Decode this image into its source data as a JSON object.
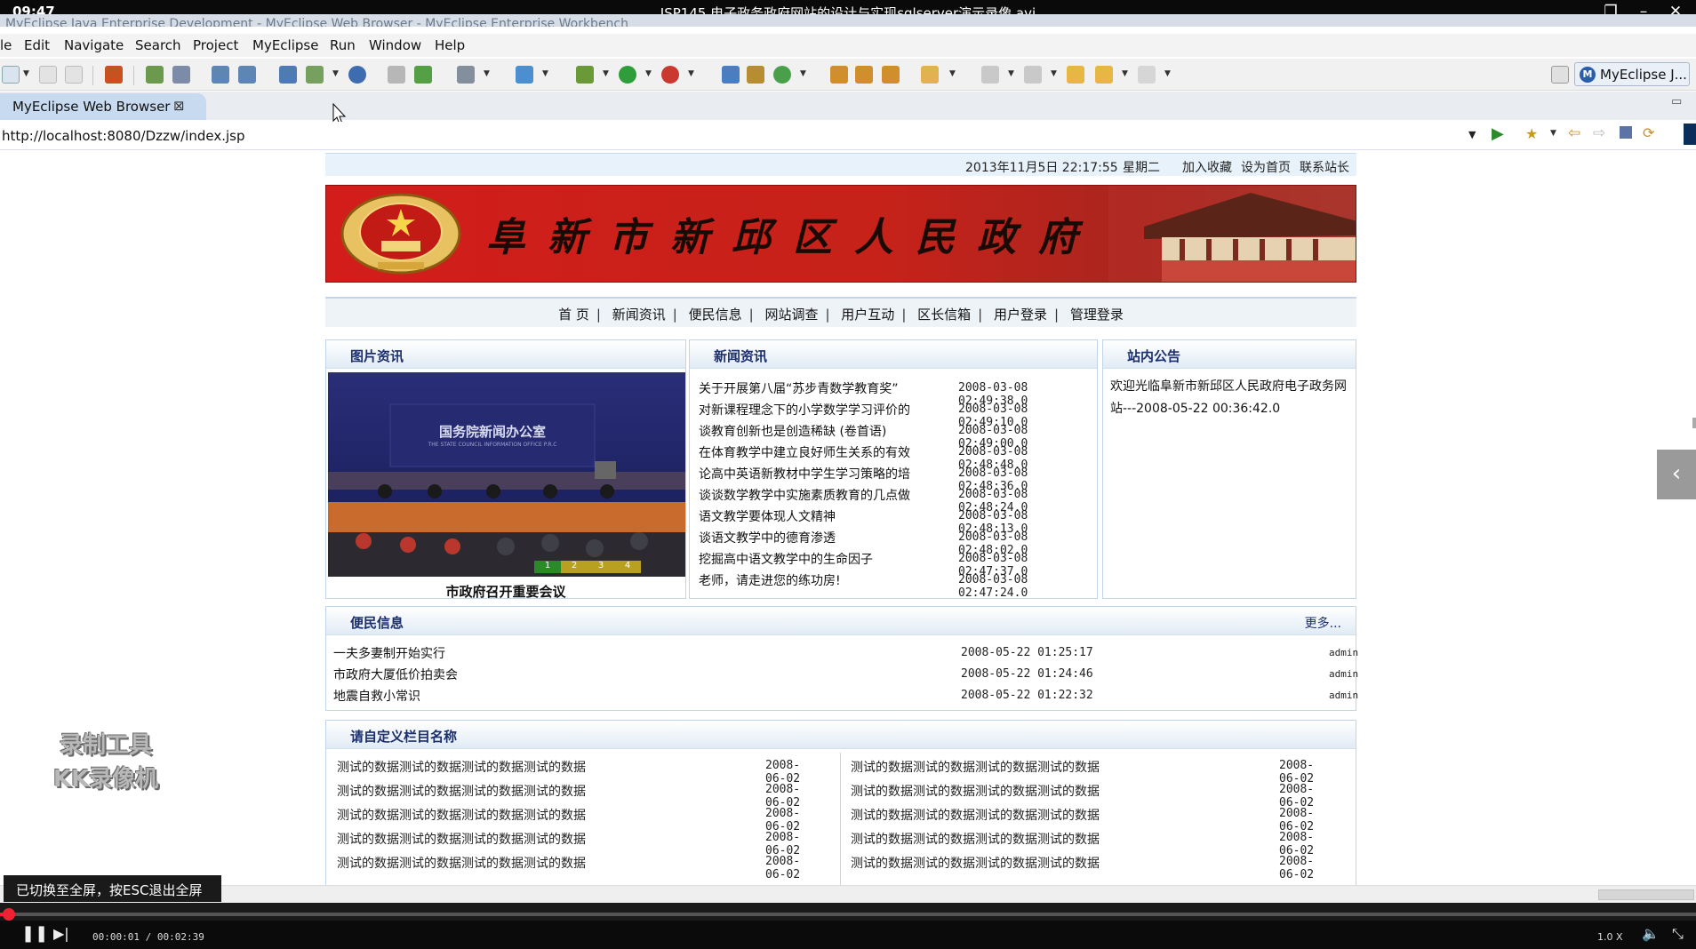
{
  "player": {
    "clock": "09:47",
    "title": "JSP145 电子政务政府网站的设计与实现sqlserver演示录像.avi",
    "time": "00:00:01 / 00:02:39",
    "speed": "1.0 X",
    "progress_fraction": 0.006,
    "toast": "已切换至全屏，按ESC退出全屏"
  },
  "ide": {
    "ghost_title": "MyEclipse Java Enterprise Development - MyEclipse Web Browser - MyEclipse Enterprise Workbench",
    "menu": [
      "le",
      "Edit",
      "Navigate",
      "Search",
      "Project",
      "MyEclipse",
      "Run",
      "Window",
      "Help"
    ],
    "perspective": "MyEclipse J...",
    "tab_label": "MyEclipse Web Browser",
    "url": "http://localhost:8080/Dzzw/index.jsp"
  },
  "site": {
    "datetime": "2013年11月5日 22:17:55",
    "weekday": "星期二",
    "top_links": [
      "加入收藏",
      "设为首页",
      "联系站长"
    ],
    "banner_title": "阜新市新邱区人民政府",
    "nav": [
      "首 页",
      "新闻资讯",
      "便民信息",
      "网站调查",
      "用户互动",
      "区长信箱",
      "用户登录",
      "管理登录"
    ],
    "photo_panel": {
      "title": "图片资讯",
      "photo_sign": "国务院新闻办公室",
      "photo_sign_sub": "THE STATE COUNCIL INFORMATION OFFICE P.R.C",
      "slides": [
        "1",
        "2",
        "3",
        "4"
      ],
      "caption": "市政府召开重要会议"
    },
    "news_panel": {
      "title": "新闻资讯",
      "items": [
        {
          "title": "关于开展第八届“苏步青数学教育奖”",
          "date": "2008-03-08 02:49:38.0"
        },
        {
          "title": "对新课程理念下的小学数学学习评价的",
          "date": "2008-03-08 02:49:10.0"
        },
        {
          "title": "谈教育创新也是创造稀缺 (卷首语)",
          "date": "2008-03-08 02:49:00.0"
        },
        {
          "title": "在体育教学中建立良好师生关系的有效",
          "date": "2008-03-08 02:48:48.0"
        },
        {
          "title": "论高中英语新教材中学生学习策略的培",
          "date": "2008-03-08 02:48:36.0"
        },
        {
          "title": "谈谈数学教学中实施素质教育的几点做",
          "date": "2008-03-08 02:48:24.0"
        },
        {
          "title": "语文教学要体现人文精神",
          "date": "2008-03-08 02:48:13.0"
        },
        {
          "title": "谈语文教学中的德育渗透",
          "date": "2008-03-08 02:48:02.0"
        },
        {
          "title": "挖掘高中语文教学中的生命因子",
          "date": "2008-03-08 02:47:37.0"
        },
        {
          "title": "老师，请走进您的练功房!",
          "date": "2008-03-08 02:47:24.0"
        }
      ]
    },
    "notice_panel": {
      "title": "站内公告",
      "text": "欢迎光临阜新市新邱区人民政府电子政务网站---2008-05-22 00:36:42.0"
    },
    "convenience": {
      "title": "便民信息",
      "more": "更多...",
      "items": [
        {
          "title": "一夫多妻制开始实行",
          "date": "2008-05-22 01:25:17",
          "author": "admin"
        },
        {
          "title": "市政府大厦低价拍卖会",
          "date": "2008-05-22 01:24:46",
          "author": "admin"
        },
        {
          "title": "地震自救小常识",
          "date": "2008-05-22 01:22:32",
          "author": "admin"
        }
      ]
    },
    "custom": {
      "title": "请自定义栏目名称",
      "left": [
        {
          "title": "测试的数据测试的数据测试的数据测试的数据",
          "date": "2008-06-02"
        },
        {
          "title": "测试的数据测试的数据测试的数据测试的数据",
          "date": "2008-06-02"
        },
        {
          "title": "测试的数据测试的数据测试的数据测试的数据",
          "date": "2008-06-02"
        },
        {
          "title": "测试的数据测试的数据测试的数据测试的数据",
          "date": "2008-06-02"
        },
        {
          "title": "测试的数据测试的数据测试的数据测试的数据",
          "date": "2008-06-02"
        }
      ],
      "right": [
        {
          "title": "测试的数据测试的数据测试的数据测试的数据",
          "date": "2008-06-02"
        },
        {
          "title": "测试的数据测试的数据测试的数据测试的数据",
          "date": "2008-06-02"
        },
        {
          "title": "测试的数据测试的数据测试的数据测试的数据",
          "date": "2008-06-02"
        },
        {
          "title": "测试的数据测试的数据测试的数据测试的数据",
          "date": "2008-06-02"
        },
        {
          "title": "测试的数据测试的数据测试的数据测试的数据",
          "date": "2008-06-02"
        }
      ]
    }
  },
  "watermark": [
    "录制工具",
    "KK录像机"
  ],
  "colors": {
    "banner_red": "#d31d1a",
    "heading_blue": "#1b2f6e",
    "panel_border": "#c2d4e8",
    "progress_red": "#ee2233"
  }
}
